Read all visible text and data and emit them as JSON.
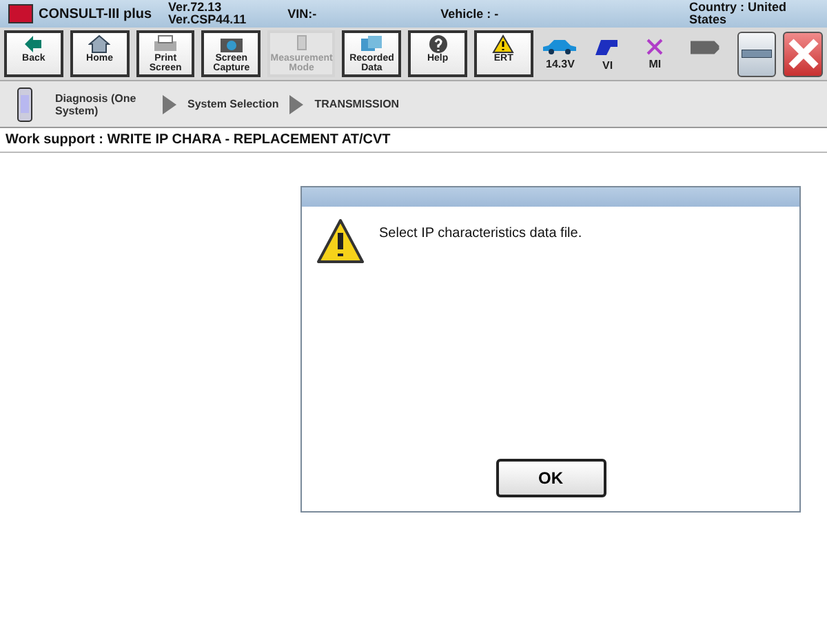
{
  "header": {
    "app_name": "CONSULT-III plus",
    "versions": [
      "Ver.72.13",
      "Ver.CSP44.11"
    ],
    "vin": "VIN:-",
    "vehicle": "Vehicle : -",
    "country": "Country : United States"
  },
  "toolbar": [
    {
      "label": "Back",
      "disabled": false
    },
    {
      "label": "Home",
      "disabled": false
    },
    {
      "label": "Print Screen",
      "disabled": false
    },
    {
      "label": "Screen Capture",
      "disabled": false
    },
    {
      "label": "Measurement Mode",
      "disabled": true
    },
    {
      "label": "Recorded Data",
      "disabled": false
    },
    {
      "label": "Help",
      "disabled": false
    },
    {
      "label": "ERT",
      "disabled": false
    }
  ],
  "status": [
    {
      "label": "14.3V"
    },
    {
      "label": "VI"
    },
    {
      "label": "MI"
    }
  ],
  "breadcrumb": [
    "Diagnosis (One System)",
    "System Selection",
    "TRANSMISSION"
  ],
  "work_support": "Work support : WRITE IP CHARA - REPLACEMENT AT/CVT",
  "dialog": {
    "message": "Select IP characteristics data file.",
    "button": "OK"
  }
}
